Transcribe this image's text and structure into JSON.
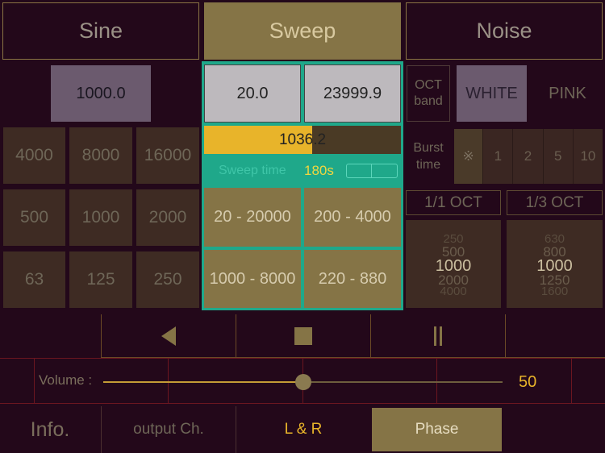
{
  "modes": {
    "sine": "Sine",
    "sweep": "Sweep",
    "noise": "Noise"
  },
  "sine": {
    "frequency": "1000.0",
    "presets": [
      "4000",
      "8000",
      "16000",
      "500",
      "1000",
      "2000",
      "63",
      "125",
      "250"
    ]
  },
  "sweep": {
    "start_freq": "20.0",
    "end_freq": "23999.9",
    "current_freq": "1036.2",
    "progress": 0.55,
    "sweep_time_label": "Sweep time",
    "sweep_time_value": "180s",
    "ranges": [
      "20 - 20000",
      "200 - 4000",
      "1000 - 8000",
      "220 - 880"
    ]
  },
  "noise": {
    "oct_band_label": "OCT band",
    "white": "WHITE",
    "pink": "PINK",
    "burst_time_label": "Burst time",
    "burst_options": [
      "※",
      "1",
      "2",
      "5",
      "10"
    ],
    "oct_1_1": "1/1 OCT",
    "oct_1_3": "1/3 OCT",
    "wheel_1_1": [
      "250",
      "500",
      "1000",
      "2000",
      "4000"
    ],
    "wheel_1_3": [
      "630",
      "800",
      "1000",
      "1250",
      "1600"
    ]
  },
  "transport": {
    "back_icon": "back-triangle-icon",
    "stop_icon": "stop-square-icon",
    "pause_icon": "pause-bars-icon"
  },
  "volume": {
    "label": "Volume :",
    "value": "50",
    "level": 0.5
  },
  "bottom": {
    "info": "Info.",
    "output": "output Ch.",
    "channel": "L & R",
    "phase": "Phase"
  },
  "colors": {
    "accent": "#e8b42a",
    "teal": "#1fa88a",
    "gold": "#857446",
    "background": "#23081a"
  }
}
